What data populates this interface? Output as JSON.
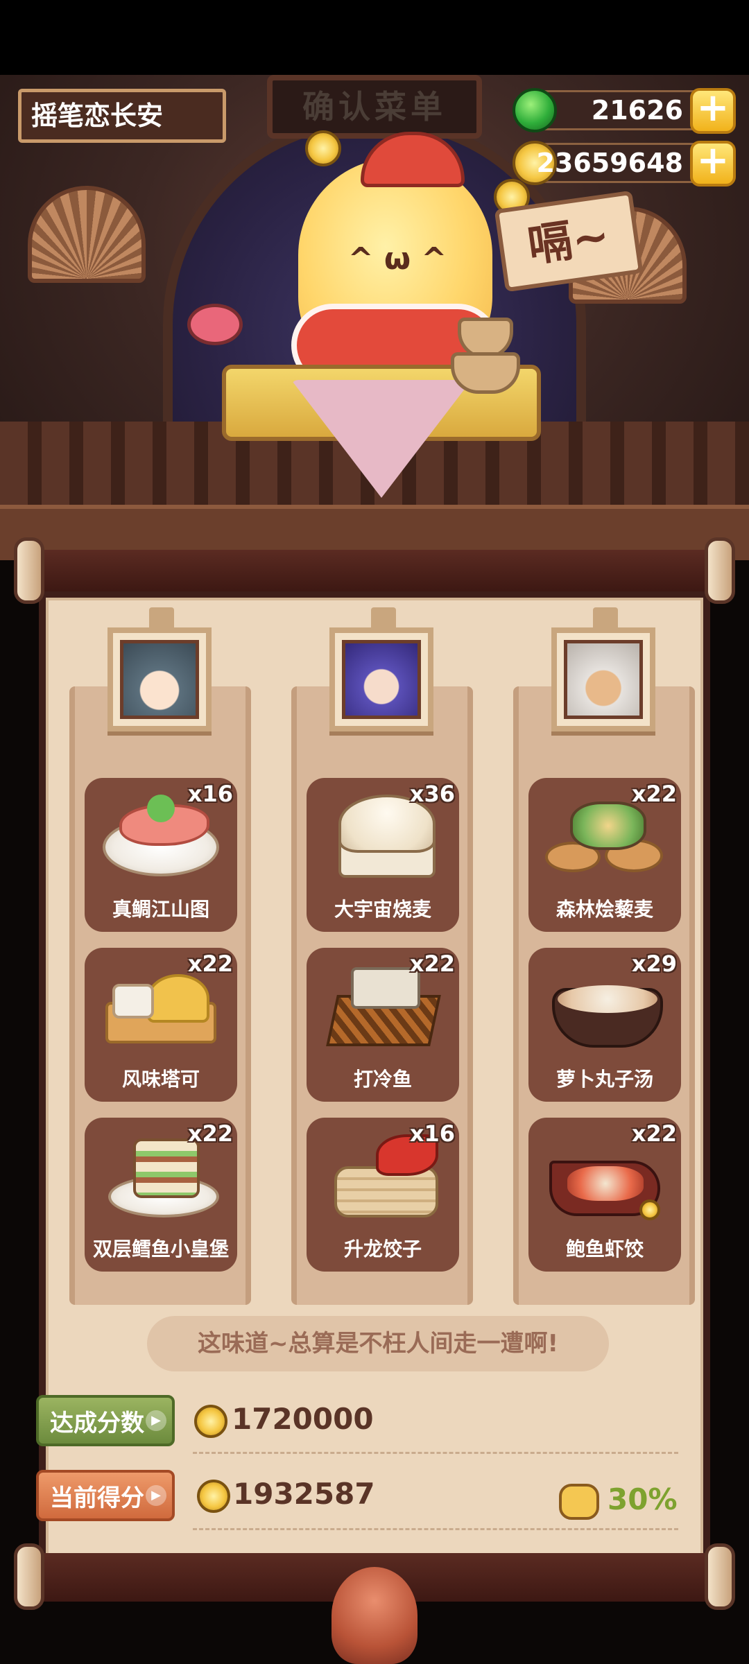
{
  "header": {
    "player_name": "摇笔恋长安",
    "shop_sign": "确认菜单",
    "jade_amount": "21626",
    "coin_amount": "23659648",
    "plus_symbol": "+"
  },
  "scene": {
    "speech": "嗝~",
    "chef_face": "^ ω ^"
  },
  "guests": [
    {
      "portrait_name": "guest-1",
      "hair_color": "#5b6f7c",
      "dishes": [
        {
          "name": "真鲷江山图",
          "count": "x16",
          "icon": "fish-platter"
        },
        {
          "name": "风味塔可",
          "count": "x22",
          "icon": "taco-board"
        },
        {
          "name": "双层鳕鱼小皇堡",
          "count": "x22",
          "icon": "burger-plate"
        }
      ]
    },
    {
      "portrait_name": "guest-2",
      "hair_color": "#5a4fb6",
      "dishes": [
        {
          "name": "大宇宙烧麦",
          "count": "x36",
          "icon": "shaomai-basket"
        },
        {
          "name": "打冷鱼",
          "count": "x22",
          "icon": "cold-fish-tray"
        },
        {
          "name": "升龙饺子",
          "count": "x16",
          "icon": "dragon-dumpling-steamer"
        }
      ]
    },
    {
      "portrait_name": "guest-3",
      "hair_color": "#e6e2de",
      "dishes": [
        {
          "name": "森林烩藜麦",
          "count": "x22",
          "icon": "quinoa-boards"
        },
        {
          "name": "萝卜丸子汤",
          "count": "x29",
          "icon": "meatball-soup-pot"
        },
        {
          "name": "鲍鱼虾饺",
          "count": "x22",
          "icon": "abalone-boat"
        }
      ]
    }
  ],
  "result": {
    "comment": "这味道~总算是不枉人间走一遭啊!",
    "target_label": "达成分数",
    "target_score": "1720000",
    "current_label": "当前得分",
    "current_score": "1932587",
    "bonus_percent": "30%"
  },
  "colors": {
    "parchment": "#ecd7bd",
    "dish_card": "#7e4b3b",
    "target_tag": "#6c8b3d",
    "current_tag": "#d06a3d",
    "bonus_text": "#7ea22f"
  }
}
